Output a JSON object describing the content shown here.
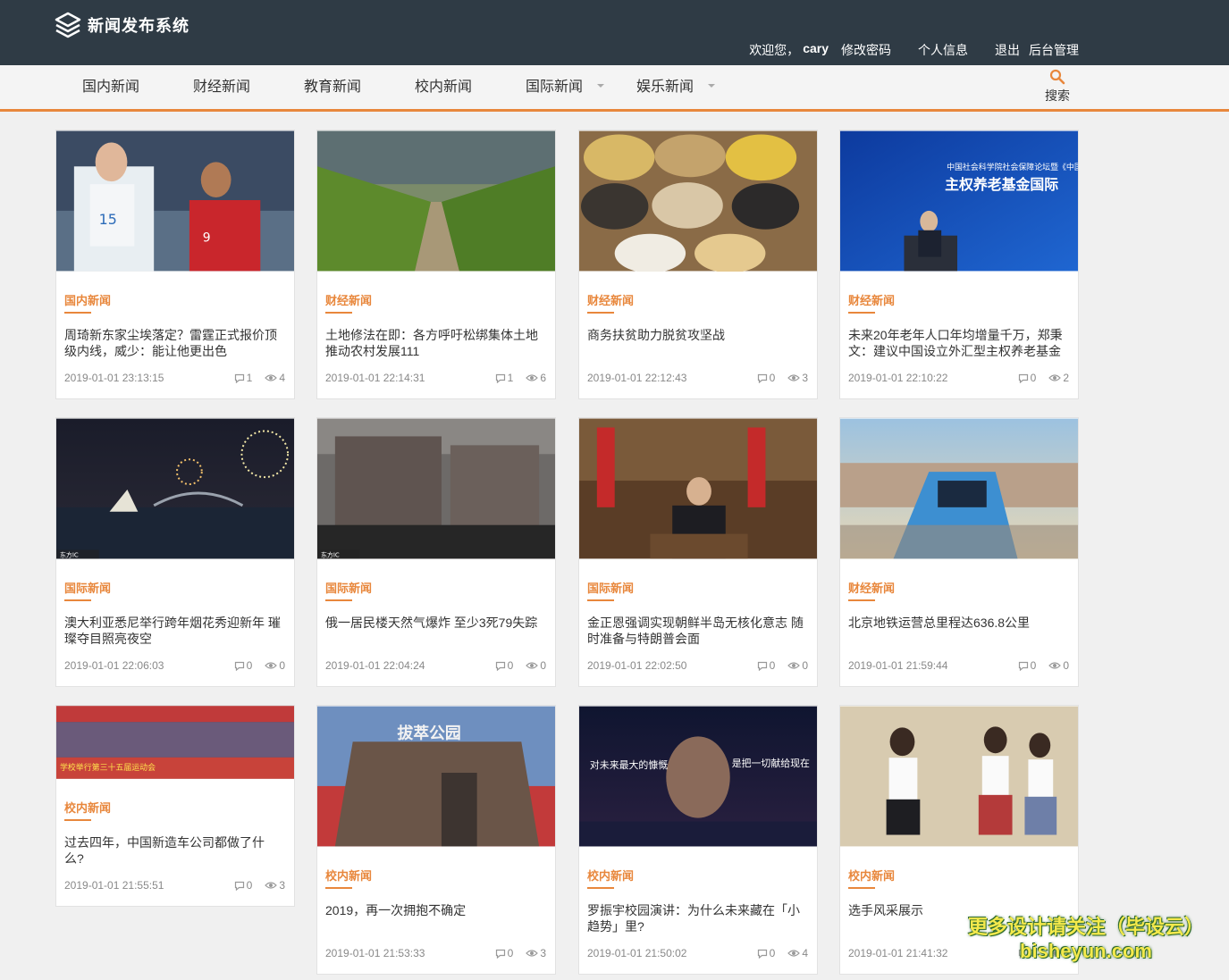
{
  "header": {
    "app_title": "新闻发布系统",
    "welcome": "欢迎您，",
    "username": "cary",
    "links": [
      "修改密码",
      "个人信息",
      "退出",
      "后台管理"
    ]
  },
  "nav": {
    "items": [
      {
        "label": "国内新闻",
        "dropdown": false
      },
      {
        "label": "财经新闻",
        "dropdown": false
      },
      {
        "label": "教育新闻",
        "dropdown": false
      },
      {
        "label": "校内新闻",
        "dropdown": false
      },
      {
        "label": "国际新闻",
        "dropdown": true
      },
      {
        "label": "娱乐新闻",
        "dropdown": true
      }
    ],
    "search_label": "搜索"
  },
  "accent_color": "#e8873c",
  "articles": [
    {
      "category": "国内新闻",
      "title": "周琦新东家尘埃落定？雷霆正式报价顶级内线，威少：能让他更出色",
      "date": "2019-01-01 23:13:15",
      "comments": "1",
      "views": "4",
      "image": "basketball-players"
    },
    {
      "category": "财经新闻",
      "title": "土地修法在即：各方呼吁松绑集体土地推动农村发展111",
      "date": "2019-01-01 22:14:31",
      "comments": "1",
      "views": "6",
      "image": "corn-field-road"
    },
    {
      "category": "财经新闻",
      "title": "商务扶贫助力脱贫攻坚战",
      "date": "2019-01-01 22:12:43",
      "comments": "0",
      "views": "3",
      "image": "grain-sacks"
    },
    {
      "category": "财经新闻",
      "title": "未来20年老年人口年均增量千万，郑秉文：建议中国设立外汇型主权养老基金",
      "date": "2019-01-01 22:10:22",
      "comments": "0",
      "views": "2",
      "image": "conference-stage"
    },
    {
      "category": "国际新闻",
      "title": "澳大利亚悉尼举行跨年烟花秀迎新年 璀璨夺目照亮夜空",
      "date": "2019-01-01 22:06:03",
      "comments": "0",
      "views": "0",
      "image": "fireworks-harbor"
    },
    {
      "category": "国际新闻",
      "title": "俄一居民楼天然气爆炸 至少3死79失踪",
      "date": "2019-01-01 22:04:24",
      "comments": "0",
      "views": "0",
      "image": "damaged-building"
    },
    {
      "category": "国际新闻",
      "title": "金正恩强调实现朝鲜半岛无核化意志 随时准备与特朗普会面",
      "date": "2019-01-01 22:02:50",
      "comments": "0",
      "views": "0",
      "image": "speech-office"
    },
    {
      "category": "财经新闻",
      "title": "北京地铁运营总里程达636.8公里",
      "date": "2019-01-01 21:59:44",
      "comments": "0",
      "views": "0",
      "image": "subway-train"
    },
    {
      "category": "校内新闻",
      "title": "过去四年，中国新造车公司都做了什么?",
      "date": "2019-01-01 21:55:51",
      "comments": "0",
      "views": "3",
      "image": "sports-meeting"
    },
    {
      "category": "校内新闻",
      "title": "2019，再一次拥抱不确定",
      "date": "2019-01-01 21:53:33",
      "comments": "0",
      "views": "3",
      "image": "park-building"
    },
    {
      "category": "校内新闻",
      "title": "罗振宇校园演讲：为什么未来藏在「小趋势」里?",
      "date": "2019-01-01 21:50:02",
      "comments": "0",
      "views": "4",
      "image": "stage-speech"
    },
    {
      "category": "校内新闻",
      "title": "选手风采展示",
      "date": "2019-01-01 21:41:32",
      "comments": "0",
      "views": "0",
      "image": "students-performance"
    }
  ],
  "image_captions": {
    "card4": "中国社会科学院社会保障论坛暨《中国",
    "card4b": "主权养老基金国际",
    "card9": "学校举行第三十五届运动会",
    "card10": "拔萃公园",
    "card11a": "对未来最大的慷慨",
    "card11b": "是把一切献给现在",
    "tag_dfic": "东方IC"
  },
  "watermark": {
    "line1": "更多设计请关注（毕设云）",
    "line2": "bisheyun.com"
  }
}
